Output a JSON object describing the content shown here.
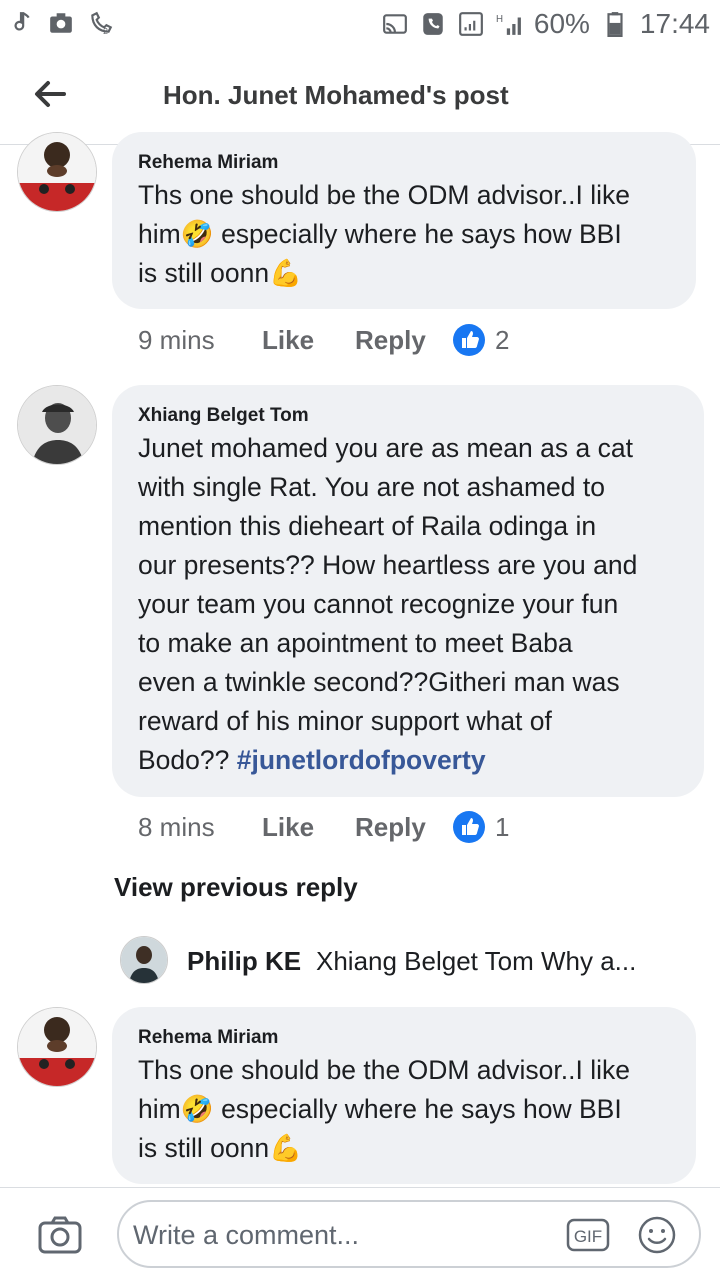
{
  "status_bar": {
    "battery": "60%",
    "time": "17:44"
  },
  "header": {
    "title": "Hon. Junet Mohamed's post"
  },
  "comments": [
    {
      "author": "Rehema Miriam",
      "line1": "Ths one should be the ODM advisor..I like",
      "line2a": "him",
      "line2b": " especially where he says how BBI",
      "line3": "is still oonn",
      "time": "9 mins",
      "like": "Like",
      "reply": "Reply",
      "reactions": "2"
    },
    {
      "author": "Xhiang Belget Tom",
      "lines": [
        "Junet mohamed you are as mean as a cat",
        "with single Rat. You are not ashamed to",
        "mention this dieheart of Raila odinga in",
        "our presents?? How heartless are you and",
        "your team you cannot recognize your fun",
        "to make an apointment to meet Baba",
        "even a twinkle second??Githeri man was",
        "reward of his minor support what of"
      ],
      "last_line": "Bodo?? ",
      "hashtag": "#junetlordofpoverty",
      "time": "8 mins",
      "like": "Like",
      "reply": "Reply",
      "reactions": "1"
    },
    {
      "author": "Rehema Miriam",
      "line1": "Ths one should be the ODM advisor..I like",
      "line2a": "him",
      "line2b": " especially where he says how BBI",
      "line3": "is still oonn"
    }
  ],
  "view_previous": "View previous reply",
  "reply_preview": {
    "name": "Philip KE",
    "text": "Xhiang Belget Tom Why a..."
  },
  "composer": {
    "placeholder": "Write a comment...",
    "gif_label": "GIF"
  },
  "colors": {
    "bubble": "#eff1f4",
    "like_blue": "#1877f2",
    "hashtag": "#385898"
  }
}
